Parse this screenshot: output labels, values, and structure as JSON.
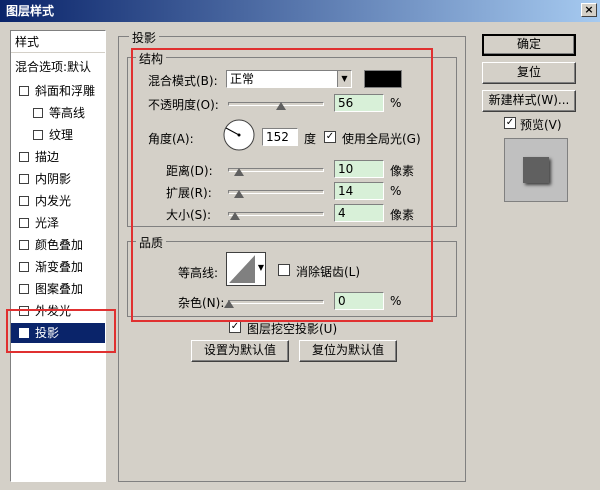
{
  "window": {
    "title": "图层样式",
    "close_glyph": "×"
  },
  "sidebar": {
    "header": "样式",
    "items": [
      {
        "label": "混合选项:默认",
        "checkbox": false,
        "checked": false,
        "indent": 0
      },
      {
        "label": "斜面和浮雕",
        "checkbox": true,
        "checked": false,
        "indent": 0
      },
      {
        "label": "等高线",
        "checkbox": true,
        "checked": false,
        "indent": 1
      },
      {
        "label": "纹理",
        "checkbox": true,
        "checked": false,
        "indent": 1
      },
      {
        "label": "描边",
        "checkbox": true,
        "checked": false,
        "indent": 0
      },
      {
        "label": "内阴影",
        "checkbox": true,
        "checked": false,
        "indent": 0
      },
      {
        "label": "内发光",
        "checkbox": true,
        "checked": false,
        "indent": 0
      },
      {
        "label": "光泽",
        "checkbox": true,
        "checked": false,
        "indent": 0
      },
      {
        "label": "颜色叠加",
        "checkbox": true,
        "checked": false,
        "indent": 0
      },
      {
        "label": "渐变叠加",
        "checkbox": true,
        "checked": false,
        "indent": 0
      },
      {
        "label": "图案叠加",
        "checkbox": true,
        "checked": false,
        "indent": 0
      },
      {
        "label": "外发光",
        "checkbox": true,
        "checked": false,
        "indent": 0
      },
      {
        "label": "投影",
        "checkbox": true,
        "checked": true,
        "indent": 0,
        "selected": true
      }
    ]
  },
  "panel": {
    "title": "投影",
    "structure": {
      "title": "结构",
      "blend_mode_label": "混合模式(B):",
      "blend_mode_value": "正常",
      "blend_color": "#000000",
      "opacity_label": "不透明度(O):",
      "opacity_value": "56",
      "opacity_unit": "%",
      "angle_label": "角度(A):",
      "angle_value": "152",
      "angle_unit": "度",
      "global_light_label": "使用全局光(G)",
      "global_light_checked": true,
      "distance_label": "距离(D):",
      "distance_value": "10",
      "distance_unit": "像素",
      "spread_label": "扩展(R):",
      "spread_value": "14",
      "spread_unit": "%",
      "size_label": "大小(S):",
      "size_value": "4",
      "size_unit": "像素"
    },
    "quality": {
      "title": "品质",
      "contour_label": "等高线:",
      "antialias_label": "消除锯齿(L)",
      "antialias_checked": false,
      "noise_label": "杂色(N):",
      "noise_value": "0",
      "noise_unit": "%"
    },
    "knockout_label": "图层挖空投影(U)",
    "knockout_checked": true,
    "make_default_label": "设置为默认值",
    "reset_default_label": "复位为默认值"
  },
  "buttons": {
    "ok": "确定",
    "reset": "复位",
    "new_style": "新建样式(W)...",
    "preview_label": "预览(V)",
    "preview_checked": true
  },
  "check_glyph": "✓"
}
